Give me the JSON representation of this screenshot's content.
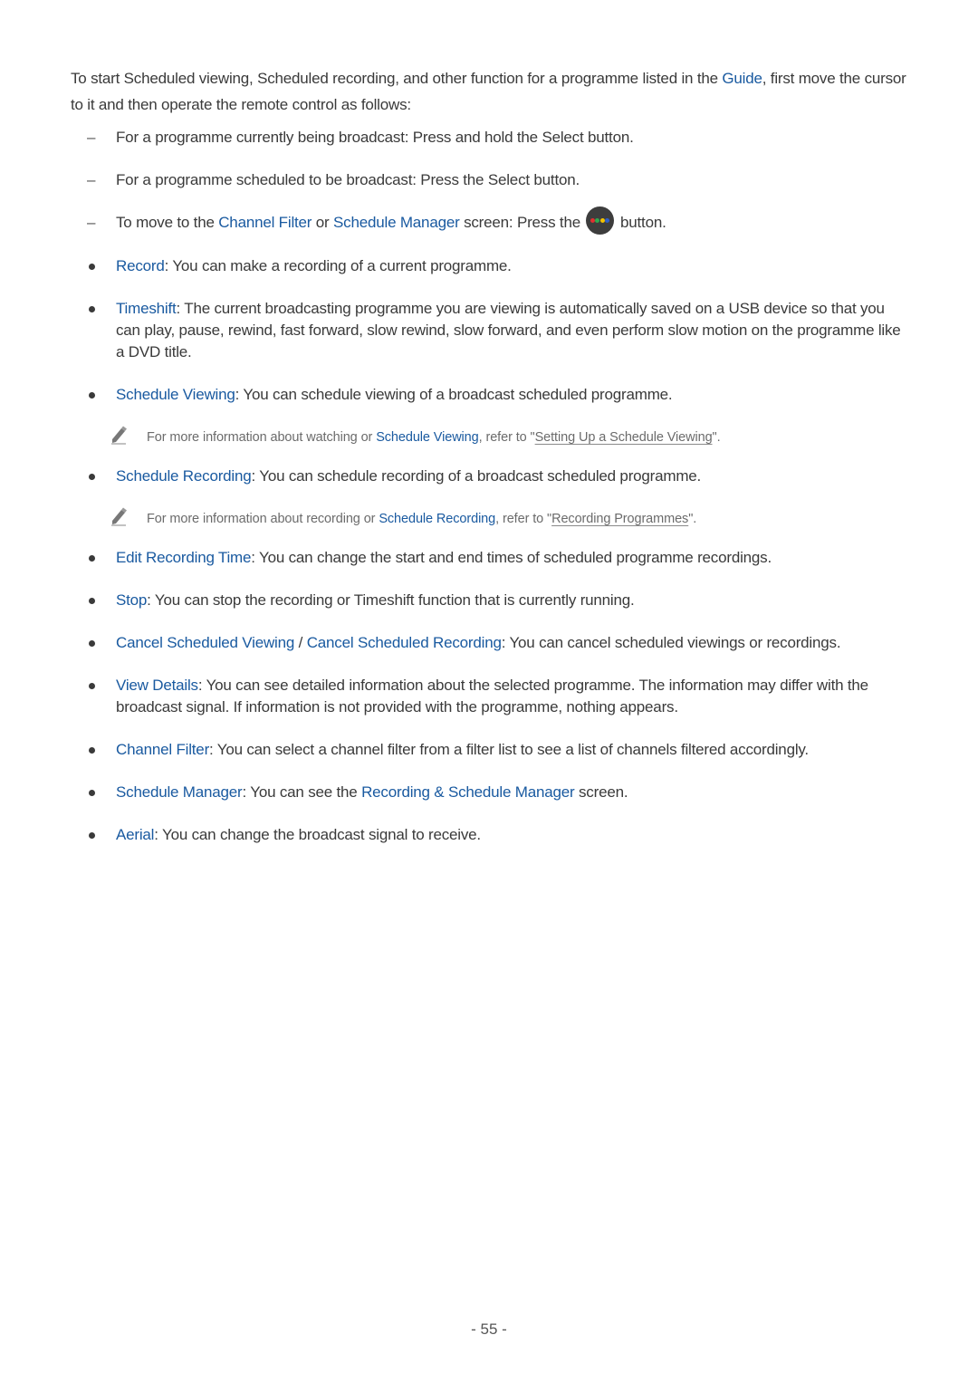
{
  "intro": {
    "text_1": "To start Scheduled viewing, Scheduled recording, and other function for a programme listed in the ",
    "link_guide": "Guide",
    "text_2": ", first move the cursor to it and then operate the remote control as follows:"
  },
  "dash_items": [
    {
      "text": "For a programme currently being broadcast: Press and hold the Select button."
    },
    {
      "text": "For a programme scheduled to be broadcast: Press the Select button."
    },
    {
      "text_1": "To move to the ",
      "link_1": "Channel Filter",
      "text_2": " or ",
      "link_2": "Schedule Manager",
      "text_3": " screen: Press the ",
      "button_icon": "color-buttons-icon",
      "text_4": " button."
    }
  ],
  "color_button": {
    "background": "#3d3d3d",
    "dots": [
      "#e03030",
      "#2fa84f",
      "#f2c200",
      "#2f5fc8"
    ]
  },
  "bullets": [
    {
      "term": "Record",
      "text": ": You can make a recording of a current programme."
    },
    {
      "term": "Timeshift",
      "text": ": The current broadcasting programme you are viewing is automatically saved on a USB device so that you can play, pause, rewind, fast forward, slow rewind, slow forward, and even perform slow motion on the programme like a DVD title."
    },
    {
      "term": "Schedule Viewing",
      "text": ": You can schedule viewing of a broadcast scheduled programme.",
      "note": {
        "icon": "pencil-icon",
        "text_1": "For more information about watching or ",
        "link": "Schedule Viewing",
        "text_2": ", refer to \"",
        "ref": "Setting Up a Schedule Viewing",
        "text_3": "\"."
      }
    },
    {
      "term": "Schedule Recording",
      "text": ": You can schedule recording of a broadcast scheduled programme.",
      "note": {
        "icon": "pencil-icon",
        "text_1": "For more information about recording or ",
        "link": "Schedule Recording",
        "text_2": ", refer to \"",
        "ref": "Recording Programmes",
        "text_3": "\"."
      }
    },
    {
      "term": "Edit Recording Time",
      "text": ": You can change the start and end times of scheduled programme recordings."
    },
    {
      "term": "Stop",
      "text": ": You can stop the recording or Timeshift function that is currently running."
    },
    {
      "term": "Cancel Scheduled Viewing",
      "sep": " / ",
      "term_2": "Cancel Scheduled Recording",
      "text": ": You can cancel scheduled viewings or recordings."
    },
    {
      "term": "View Details",
      "text": ": You can see detailed information about the selected programme. The information may differ with the broadcast signal. If information is not provided with the programme, nothing appears."
    },
    {
      "term": "Channel Filter",
      "text": ": You can select a channel filter from a filter list to see a list of channels filtered accordingly."
    },
    {
      "term": "Schedule Manager",
      "text": ": You can see the ",
      "term_2": "Recording & Schedule Manager",
      "text_2": " screen."
    },
    {
      "term": "Aerial",
      "text": ": You can change the broadcast signal to receive."
    }
  ],
  "footer": {
    "page_number": "- 55 -"
  },
  "colors": {
    "link": "#1a5aa0",
    "body_text": "#3a3a3a",
    "note_text": "#6b6b6b"
  }
}
